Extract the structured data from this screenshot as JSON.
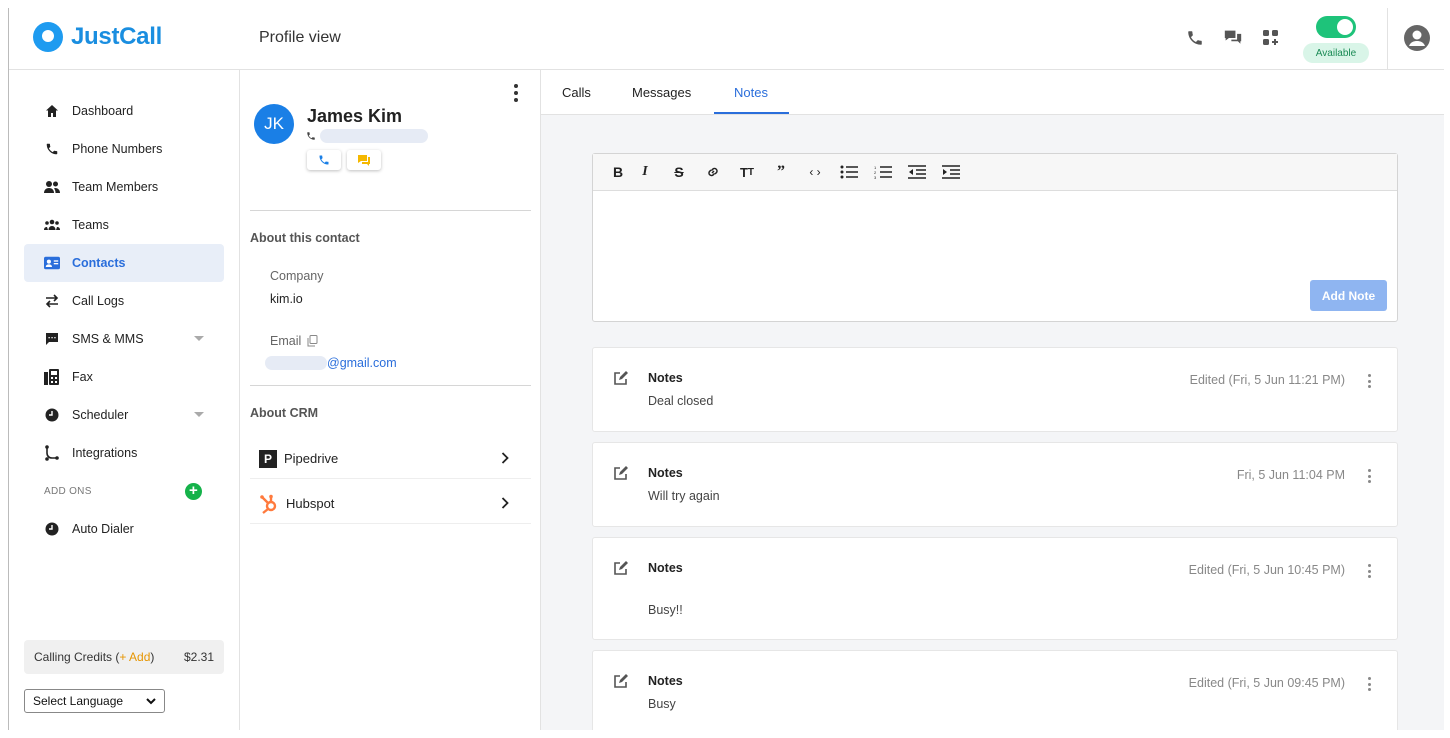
{
  "app": {
    "name": "JustCall",
    "page_title": "Profile view"
  },
  "header": {
    "status_label": "Available",
    "status_on": true,
    "accent": "#1ec37a"
  },
  "sidebar": {
    "items": [
      {
        "label": "Dashboard",
        "icon": "home-icon"
      },
      {
        "label": "Phone Numbers",
        "icon": "phone-icon"
      },
      {
        "label": "Team Members",
        "icon": "team-members-icon"
      },
      {
        "label": "Teams",
        "icon": "teams-icon"
      },
      {
        "label": "Contacts",
        "icon": "contacts-icon",
        "active": true
      },
      {
        "label": "Call Logs",
        "icon": "call-logs-icon"
      },
      {
        "label": "SMS & MMS",
        "icon": "sms-icon",
        "expandable": true
      },
      {
        "label": "Fax",
        "icon": "fax-icon"
      },
      {
        "label": "Scheduler",
        "icon": "scheduler-icon",
        "expandable": true
      },
      {
        "label": "Integrations",
        "icon": "integrations-icon"
      }
    ],
    "addons_label": "ADD ONS",
    "addon_items": [
      {
        "label": "Auto Dialer",
        "icon": "auto-dialer-icon"
      }
    ],
    "credits": {
      "prefix": "Calling Credits (",
      "add": "+ Add",
      "suffix": ")",
      "amount": "$2.31"
    },
    "language": "Select Language"
  },
  "contact": {
    "initials": "JK",
    "name": "James Kim",
    "about_title": "About this contact",
    "company_label": "Company",
    "company": "kim.io",
    "email_label": "Email",
    "email_domain": "@gmail.com",
    "crm_title": "About CRM",
    "crm_items": [
      {
        "label": "Pipedrive",
        "icon": "pipedrive-icon"
      },
      {
        "label": "Hubspot",
        "icon": "hubspot-icon"
      }
    ]
  },
  "tabs": [
    {
      "label": "Calls"
    },
    {
      "label": "Messages"
    },
    {
      "label": "Notes",
      "active": true
    }
  ],
  "editor": {
    "tools": [
      "bold-icon",
      "italic-icon",
      "strikethrough-icon",
      "link-icon",
      "heading-icon",
      "quote-icon",
      "code-icon",
      "bullet-list-icon",
      "numbered-list-icon",
      "outdent-icon",
      "indent-icon"
    ],
    "add_note_label": "Add Note"
  },
  "notes": [
    {
      "title": "Notes",
      "body": "Deal closed",
      "date": "Edited (Fri, 5 Jun 11:21 PM)"
    },
    {
      "title": "Notes",
      "body": "Will try again",
      "date": "Fri, 5 Jun 11:04 PM"
    },
    {
      "title": "Notes",
      "body": "Busy!!",
      "date": "Edited (Fri, 5 Jun 10:45 PM)"
    },
    {
      "title": "Notes",
      "body": "Busy",
      "date": "Edited (Fri, 5 Jun 09:45 PM)"
    }
  ]
}
